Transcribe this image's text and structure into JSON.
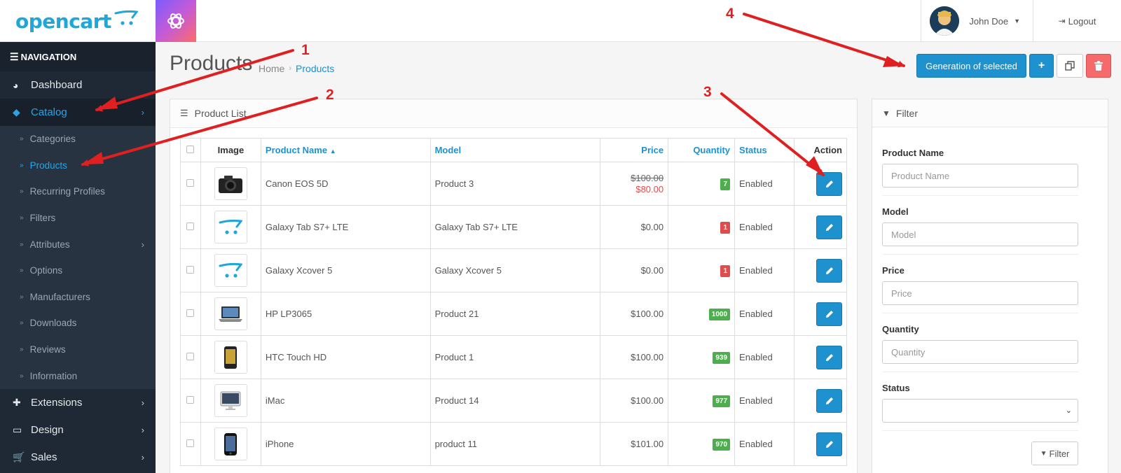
{
  "header": {
    "logo_text": "opencart",
    "user_name": "John Doe",
    "logout_label": "Logout"
  },
  "sidebar": {
    "title": "NAVIGATION",
    "items_top": [
      {
        "label": "Dashboard",
        "icon": "dashboard-icon"
      },
      {
        "label": "Catalog",
        "icon": "tag-icon",
        "active": true
      }
    ],
    "catalog_sub": [
      {
        "label": "Categories"
      },
      {
        "label": "Products",
        "active": true
      },
      {
        "label": "Recurring Profiles"
      },
      {
        "label": "Filters"
      },
      {
        "label": "Attributes",
        "has_children": true
      },
      {
        "label": "Options"
      },
      {
        "label": "Manufacturers"
      },
      {
        "label": "Downloads"
      },
      {
        "label": "Reviews"
      },
      {
        "label": "Information"
      }
    ],
    "items_bottom": [
      {
        "label": "Extensions",
        "icon": "puzzle-icon"
      },
      {
        "label": "Design",
        "icon": "monitor-icon"
      },
      {
        "label": "Sales",
        "icon": "cart-icon"
      }
    ]
  },
  "page": {
    "title": "Products",
    "breadcrumb": [
      "Home",
      "Products"
    ],
    "actions": {
      "generate_label": "Generation of selected",
      "add_label": "+"
    }
  },
  "product_list": {
    "heading": "Product List",
    "columns": {
      "image": "Image",
      "name": "Product Name",
      "model": "Model",
      "price": "Price",
      "quantity": "Quantity",
      "status": "Status",
      "action": "Action"
    },
    "rows": [
      {
        "image": "camera",
        "name": "Canon EOS 5D",
        "model": "Product 3",
        "price": "$100.00",
        "special": "$80.00",
        "quantity": "7",
        "qty_state": "ok",
        "status": "Enabled"
      },
      {
        "image": "opencart-placeholder",
        "name": "Galaxy Tab S7+ LTE",
        "model": "Galaxy Tab S7+ LTE",
        "price": "$0.00",
        "special": "",
        "quantity": "1",
        "qty_state": "low",
        "status": "Enabled"
      },
      {
        "image": "opencart-placeholder",
        "name": "Galaxy Xcover 5",
        "model": "Galaxy Xcover 5",
        "price": "$0.00",
        "special": "",
        "quantity": "1",
        "qty_state": "low",
        "status": "Enabled"
      },
      {
        "image": "laptop",
        "name": "HP LP3065",
        "model": "Product 21",
        "price": "$100.00",
        "special": "",
        "quantity": "1000",
        "qty_state": "ok",
        "status": "Enabled"
      },
      {
        "image": "phone",
        "name": "HTC Touch HD",
        "model": "Product 1",
        "price": "$100.00",
        "special": "",
        "quantity": "939",
        "qty_state": "ok",
        "status": "Enabled"
      },
      {
        "image": "imac",
        "name": "iMac",
        "model": "Product 14",
        "price": "$100.00",
        "special": "",
        "quantity": "977",
        "qty_state": "ok",
        "status": "Enabled"
      },
      {
        "image": "iphone",
        "name": "iPhone",
        "model": "product 11",
        "price": "$101.00",
        "special": "",
        "quantity": "970",
        "qty_state": "ok",
        "status": "Enabled"
      }
    ]
  },
  "filter": {
    "heading": "Filter",
    "fields": {
      "name_label": "Product Name",
      "name_placeholder": "Product Name",
      "model_label": "Model",
      "model_placeholder": "Model",
      "price_label": "Price",
      "price_placeholder": "Price",
      "quantity_label": "Quantity",
      "quantity_placeholder": "Quantity",
      "status_label": "Status",
      "status_value": ""
    },
    "button_label": "Filter"
  },
  "annotations": [
    "1",
    "2",
    "3",
    "4"
  ],
  "colors": {
    "accent": "#1e91cf",
    "sidebar_bg": "#1e2935",
    "danger": "#f56b6b",
    "success": "#4cae4c",
    "arrow": "#e02020"
  }
}
